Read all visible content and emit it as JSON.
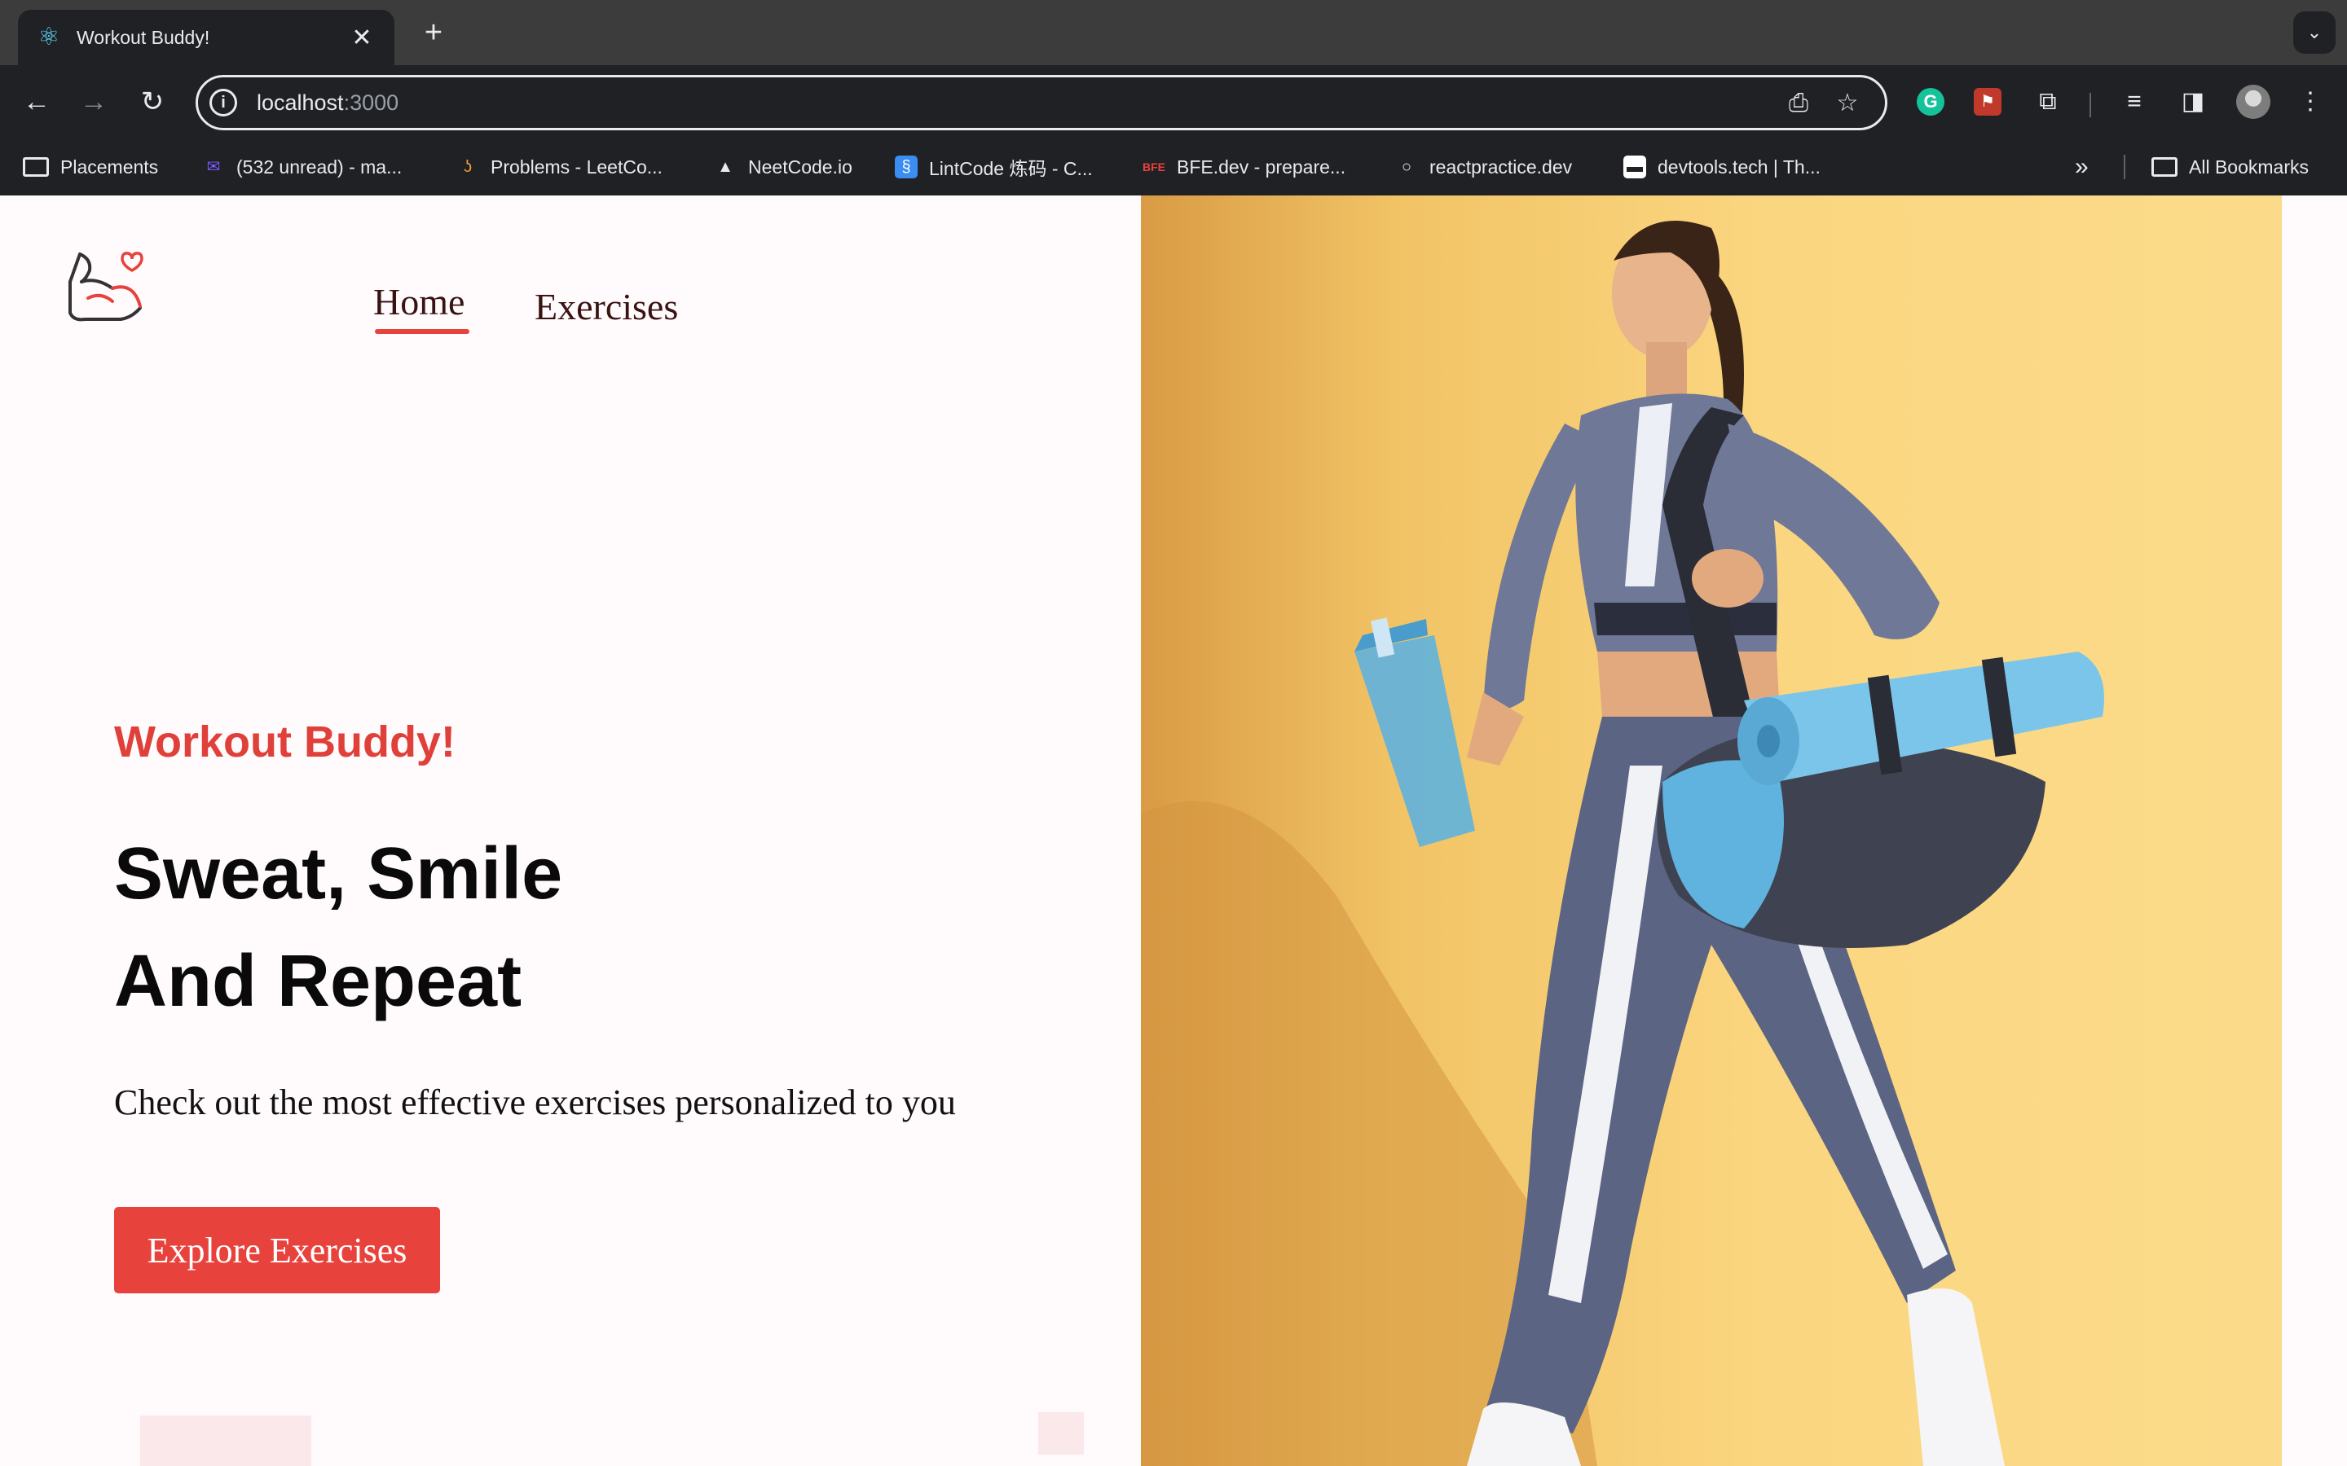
{
  "browser": {
    "tab": {
      "title": "Workout Buddy!",
      "favicon": "react-icon"
    },
    "url": {
      "host": "localhost",
      "port": ":3000"
    },
    "bookmarks": [
      {
        "label": "Placements",
        "icon": "folder-icon"
      },
      {
        "label": "(532 unread) - ma...",
        "icon": "mail-icon"
      },
      {
        "label": "Problems - LeetCo...",
        "icon": "leetcode-icon"
      },
      {
        "label": "NeetCode.io",
        "icon": "rocket-icon"
      },
      {
        "label": "LintCode 炼码 - C...",
        "icon": "lintcode-icon"
      },
      {
        "label": "BFE.dev - prepare...",
        "icon": "bfe-icon"
      },
      {
        "label": "reactpractice.dev",
        "icon": "circle-icon"
      },
      {
        "label": "devtools.tech | Th...",
        "icon": "devtools-icon"
      }
    ],
    "all_bookmarks": "All Bookmarks"
  },
  "nav": {
    "home": "Home",
    "exercises": "Exercises"
  },
  "hero": {
    "eyebrow": "Workout Buddy!",
    "headline_line1": "Sweat, Smile",
    "headline_line2": "And Repeat",
    "subtitle": "Check out the most effective exercises personalized to you",
    "cta": "Explore Exercises"
  },
  "colors": {
    "accent": "#e8423c",
    "hero_background": "#fbd680",
    "page_background": "#fffafb"
  }
}
